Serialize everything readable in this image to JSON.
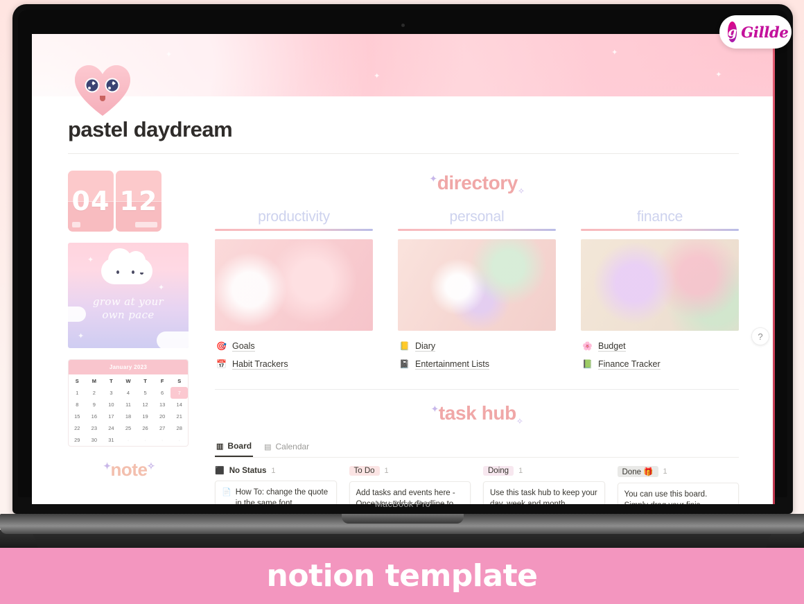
{
  "brand": {
    "mark": "g",
    "name": "Gillde"
  },
  "device": {
    "label": "MacBook Pro"
  },
  "banner": {
    "text": "notion template"
  },
  "notion": {
    "page_icon": "pink-heart-face",
    "title": "pastel daydream",
    "help_button": "?"
  },
  "widgets": {
    "flipclock": {
      "left": "04",
      "right": "12"
    },
    "quote": {
      "line1": "grow at your",
      "line2": "own pace"
    },
    "calendar": {
      "month": "January 2023",
      "dow": [
        "S",
        "M",
        "T",
        "W",
        "T",
        "F",
        "S"
      ],
      "lead_blanks": 0,
      "days": [
        1,
        2,
        3,
        4,
        5,
        6,
        7,
        8,
        9,
        10,
        11,
        12,
        13,
        14,
        15,
        16,
        17,
        18,
        19,
        20,
        21,
        22,
        23,
        24,
        25,
        26,
        27,
        28,
        29,
        30,
        31
      ],
      "highlight": 7,
      "trailing_blanks": 4
    },
    "note": {
      "label": "note",
      "sparkle_left": "✦",
      "sparkle_right": "✧"
    }
  },
  "directory": {
    "title": "directory",
    "sparkle_left": "✦",
    "sparkle_right": "✧",
    "columns": [
      {
        "heading": "productivity",
        "thumb": "pink-planner-and-markers-photo",
        "links": [
          {
            "icon": "🎯",
            "label": "Goals"
          },
          {
            "icon": "📅",
            "label": "Habit Trackers"
          }
        ]
      },
      {
        "heading": "personal",
        "thumb": "pearl-bracelet-and-pink-bag-photo",
        "links": [
          {
            "icon": "📒",
            "label": "Diary"
          },
          {
            "icon": "📓",
            "label": "Entertainment Lists"
          }
        ]
      },
      {
        "heading": "finance",
        "thumb": "lilac-heart-purse-and-tulips-photo",
        "links": [
          {
            "icon": "🌸",
            "label": "Budget"
          },
          {
            "icon": "📗",
            "label": "Finance Tracker"
          }
        ]
      }
    ]
  },
  "task_hub": {
    "title": "task hub",
    "sparkle_left": "✦",
    "sparkle_right": "✧",
    "tabs": [
      {
        "icon": "board-icon",
        "label": "Board",
        "active": true
      },
      {
        "icon": "calendar-icon",
        "label": "Calendar",
        "active": false
      }
    ],
    "columns": [
      {
        "name": "No Status",
        "style": "plain",
        "status_icon": "⬛",
        "count": "1",
        "cards": [
          {
            "icon": "📄",
            "text": "How To: change the quote in the same font"
          }
        ]
      },
      {
        "name": "To Do",
        "style": "pill-todo",
        "count": "1",
        "cards": [
          {
            "icon": "",
            "text": "Add tasks and events here - Once you add a deadline to these tasks,"
          }
        ]
      },
      {
        "name": "Doing",
        "style": "pill-doing",
        "count": "1",
        "cards": [
          {
            "icon": "",
            "text": "Use this task hub to keep your day, week and month productive"
          }
        ]
      },
      {
        "name": "Done 🎁",
        "style": "pill-done",
        "count": "1",
        "cards": [
          {
            "icon": "",
            "text": "You can use this board. Simply drag your finis"
          }
        ]
      }
    ]
  },
  "colors": {
    "banner_pink": "#f396bf",
    "accent_pink": "#f0a7a7",
    "heading_lavender": "#cdd2ee",
    "brand_magenta": "#e6007e"
  }
}
